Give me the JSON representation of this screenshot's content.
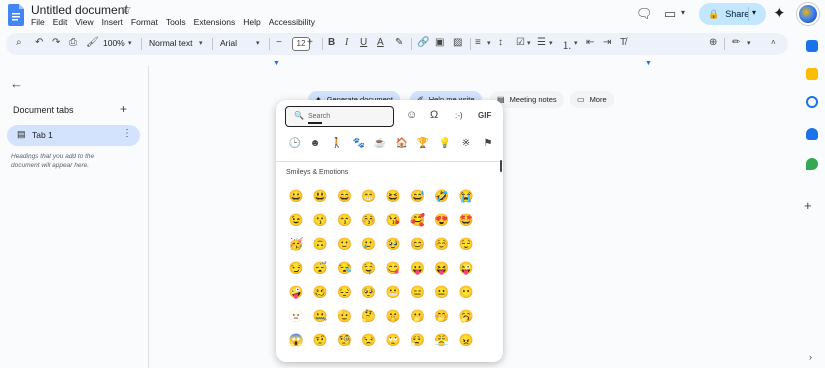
{
  "doc": {
    "title": "Untitled document",
    "menu": [
      "File",
      "Edit",
      "View",
      "Insert",
      "Format",
      "Tools",
      "Extensions",
      "Help",
      "Accessibility"
    ]
  },
  "header": {
    "share_label": "Share"
  },
  "toolbar": {
    "zoom": "100%",
    "style": "Normal text",
    "font": "Arial",
    "font_size": "12"
  },
  "sidebar": {
    "title": "Document tabs",
    "tab_label": "Tab 1",
    "hint": "Headings that you add to the document will appear here."
  },
  "chips": {
    "generate": "Generate document",
    "help_me_write": "Help me write",
    "meeting_notes": "Meeting notes",
    "more": "More"
  },
  "picker": {
    "search_placeholder": "Search",
    "emoticon_label": ":-)",
    "gif_label": "GIF",
    "section": "Smileys & Emotions",
    "emojis": [
      [
        "😀",
        "😃",
        "😄",
        "😁",
        "😆",
        "😅",
        "🤣",
        "😭"
      ],
      [
        "😉",
        "😗",
        "😙",
        "😚",
        "😘",
        "🥰",
        "😍",
        "🤩"
      ],
      [
        "🥳",
        "🙃",
        "🙂",
        "🥲",
        "🥹",
        "😊",
        "☺️",
        "😌"
      ],
      [
        "😏",
        "😴",
        "😪",
        "🤤",
        "😋",
        "😛",
        "😝",
        "😜"
      ],
      [
        "🤪",
        "🥴",
        "😔",
        "🥺",
        "😬",
        "😑",
        "😐",
        "😶"
      ],
      [
        "🫥",
        "🤐",
        "🫡",
        "🤔",
        "🤫",
        "🫢",
        "🤭",
        "🥱"
      ],
      [
        "😱",
        "🤨",
        "🧐",
        "😒",
        "🙄",
        "😮‍💨",
        "😤",
        "😠"
      ]
    ]
  }
}
